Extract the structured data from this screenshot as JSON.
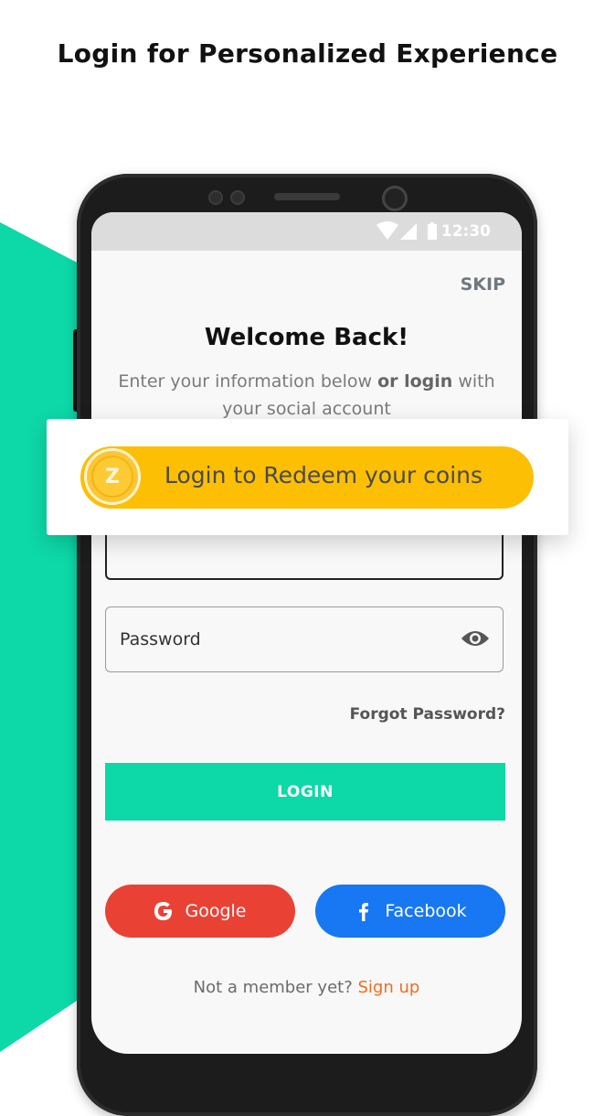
{
  "headline": "Login for Personalized Experience",
  "status_bar": {
    "time": "12:30"
  },
  "screen": {
    "skip_label": "SKIP",
    "welcome_title": "Welcome Back!",
    "subtitle_part1": "Enter your information below ",
    "subtitle_bold": "or login",
    "subtitle_part2": " with your social account",
    "password_placeholder": "Password",
    "forgot_label": "Forgot Password?",
    "login_label": "LOGIN",
    "google_label": "Google",
    "facebook_label": "Facebook",
    "signup_prompt": "Not a member yet? ",
    "signup_link": "Sign up"
  },
  "promo": {
    "coin_letter": "Z",
    "text": "Login to Redeem your coins"
  },
  "colors": {
    "teal": "#0dd8a8",
    "google": "#e94235",
    "facebook": "#1877f2",
    "coin_yellow": "#fcbf04",
    "link_orange": "#f26b1d"
  },
  "icons": [
    "wifi-icon",
    "signal-icon",
    "battery-icon",
    "eye-icon",
    "google-icon",
    "facebook-icon",
    "coin-icon"
  ]
}
